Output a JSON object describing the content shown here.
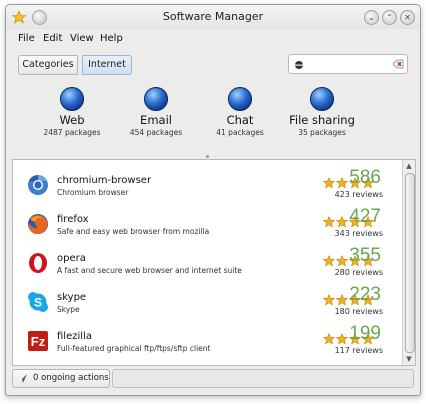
{
  "window": {
    "title": "Software Manager"
  },
  "menu": [
    "File",
    "Edit",
    "View",
    "Help"
  ],
  "breadcrumb": {
    "root": "Categories",
    "current": "Internet"
  },
  "search": {
    "value": ""
  },
  "categories": [
    {
      "name": "Web",
      "count": "2487 packages"
    },
    {
      "name": "Email",
      "count": "454 packages"
    },
    {
      "name": "Chat",
      "count": "41 packages"
    },
    {
      "name": "File sharing",
      "count": "35 packages"
    }
  ],
  "apps": [
    {
      "name": "chromium-browser",
      "description": "Chromium browser",
      "score": "586",
      "reviews": "423 reviews",
      "icon": "chromium-icon"
    },
    {
      "name": "firefox",
      "description": "Safe and easy web browser from mozilla",
      "score": "427",
      "reviews": "343 reviews",
      "icon": "firefox-icon"
    },
    {
      "name": "opera",
      "description": "A fast and secure web browser and internet suite",
      "score": "355",
      "reviews": "280 reviews",
      "icon": "opera-icon"
    },
    {
      "name": "skype",
      "description": "Skype",
      "score": "223",
      "reviews": "180 reviews",
      "icon": "skype-icon"
    },
    {
      "name": "filezilla",
      "description": "Full-featured graphical ftp/ftps/sftp client",
      "score": "199",
      "reviews": "117 reviews",
      "icon": "filezilla-icon"
    }
  ],
  "status": {
    "text": "0 ongoing actions"
  },
  "colors": {
    "score": "#6aa84f",
    "star": "#f2b01e"
  }
}
